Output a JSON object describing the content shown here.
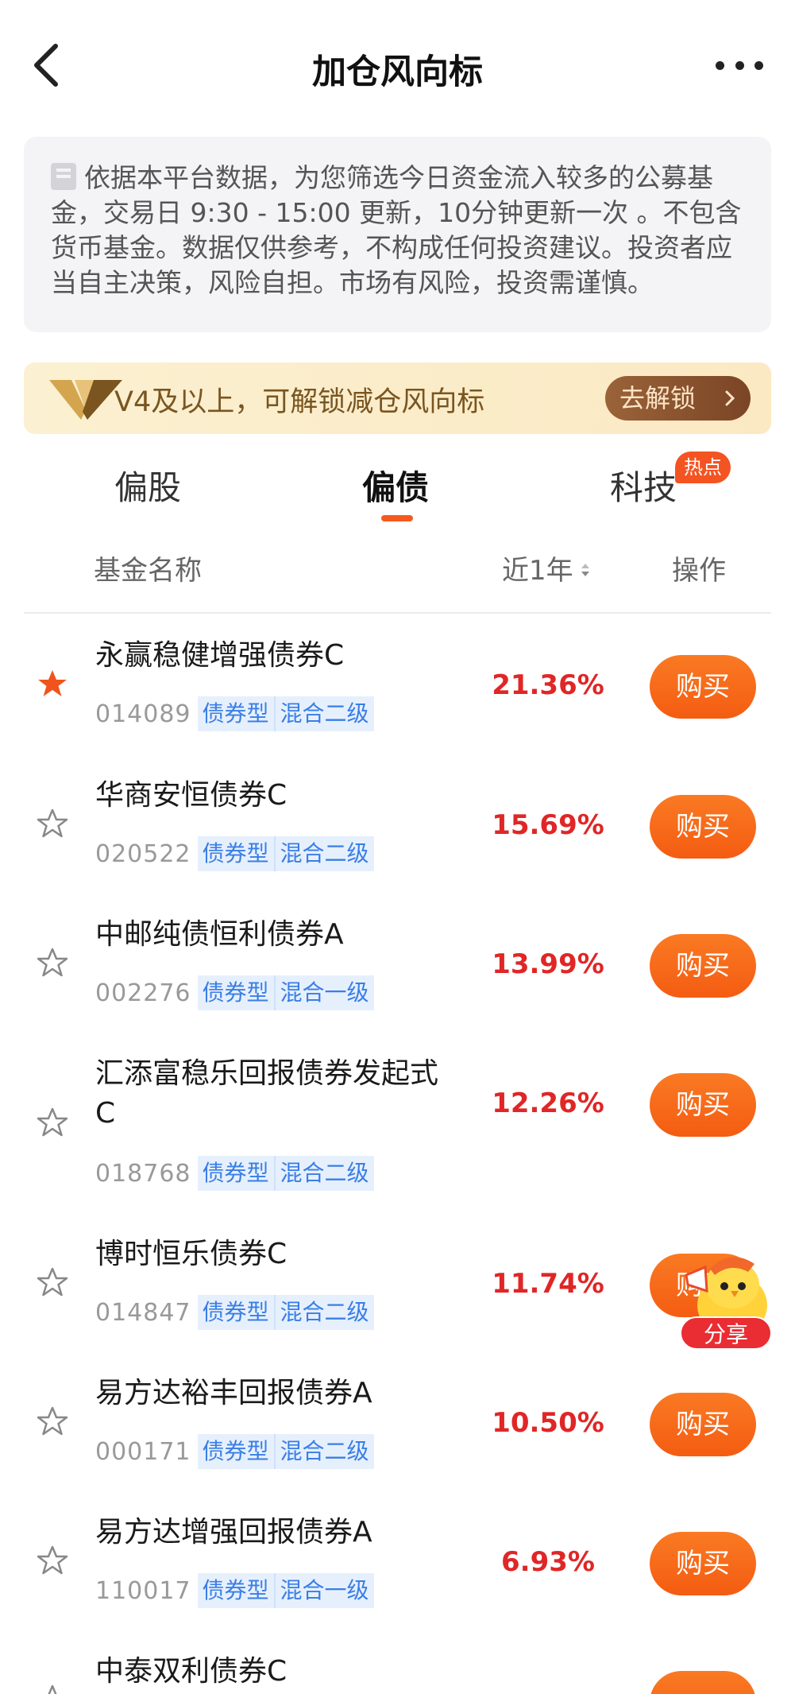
{
  "header": {
    "title": "加仓风向标"
  },
  "notice": {
    "text": "依据本平台数据，为您筛选今日资金流入较多的公募基金，交易日 9:30 - 15:00 更新，10分钟更新一次 。不包含货币基金。数据仅供参考，不构成任何投资建议。投资者应当自主决策，风险自担。市场有风险，投资需谨慎。"
  },
  "banner": {
    "text": "V4及以上，可解锁减仓风向标",
    "button": "去解锁"
  },
  "tabs": [
    {
      "label": "偏股"
    },
    {
      "label": "偏债"
    },
    {
      "label": "科技",
      "badge": "热点"
    }
  ],
  "columns": {
    "name": "基金名称",
    "return": "近1年",
    "action": "操作"
  },
  "funds": [
    {
      "name": "永赢稳健增强债券C",
      "code": "014089",
      "tag1": "债券型",
      "tag2": "混合二级",
      "ret": "21.36%",
      "buy": "购买",
      "starred": true
    },
    {
      "name": "华商安恒债券C",
      "code": "020522",
      "tag1": "债券型",
      "tag2": "混合二级",
      "ret": "15.69%",
      "buy": "购买",
      "starred": false
    },
    {
      "name": "中邮纯债恒利债券A",
      "code": "002276",
      "tag1": "债券型",
      "tag2": "混合一级",
      "ret": "13.99%",
      "buy": "购买",
      "starred": false
    },
    {
      "name": "汇添富稳乐回报债券发起式C",
      "code": "018768",
      "tag1": "债券型",
      "tag2": "混合二级",
      "ret": "12.26%",
      "buy": "购买",
      "starred": false
    },
    {
      "name": "博时恒乐债券C",
      "code": "014847",
      "tag1": "债券型",
      "tag2": "混合二级",
      "ret": "11.74%",
      "buy": "购买",
      "starred": false
    },
    {
      "name": "易方达裕丰回报债券A",
      "code": "000171",
      "tag1": "债券型",
      "tag2": "混合二级",
      "ret": "10.50%",
      "buy": "购买",
      "starred": false
    },
    {
      "name": "易方达增强回报债券A",
      "code": "110017",
      "tag1": "债券型",
      "tag2": "混合一级",
      "ret": "6.93%",
      "buy": "购买",
      "starred": false
    },
    {
      "name": "中泰双利债券C",
      "code": "",
      "tag1": "",
      "tag2": "",
      "ret": "",
      "buy": "",
      "starred": false
    }
  ],
  "float": {
    "share": "分享"
  },
  "colors": {
    "accent": "#f45c12",
    "return": "#e02626",
    "tag": "#3a7ee6"
  }
}
